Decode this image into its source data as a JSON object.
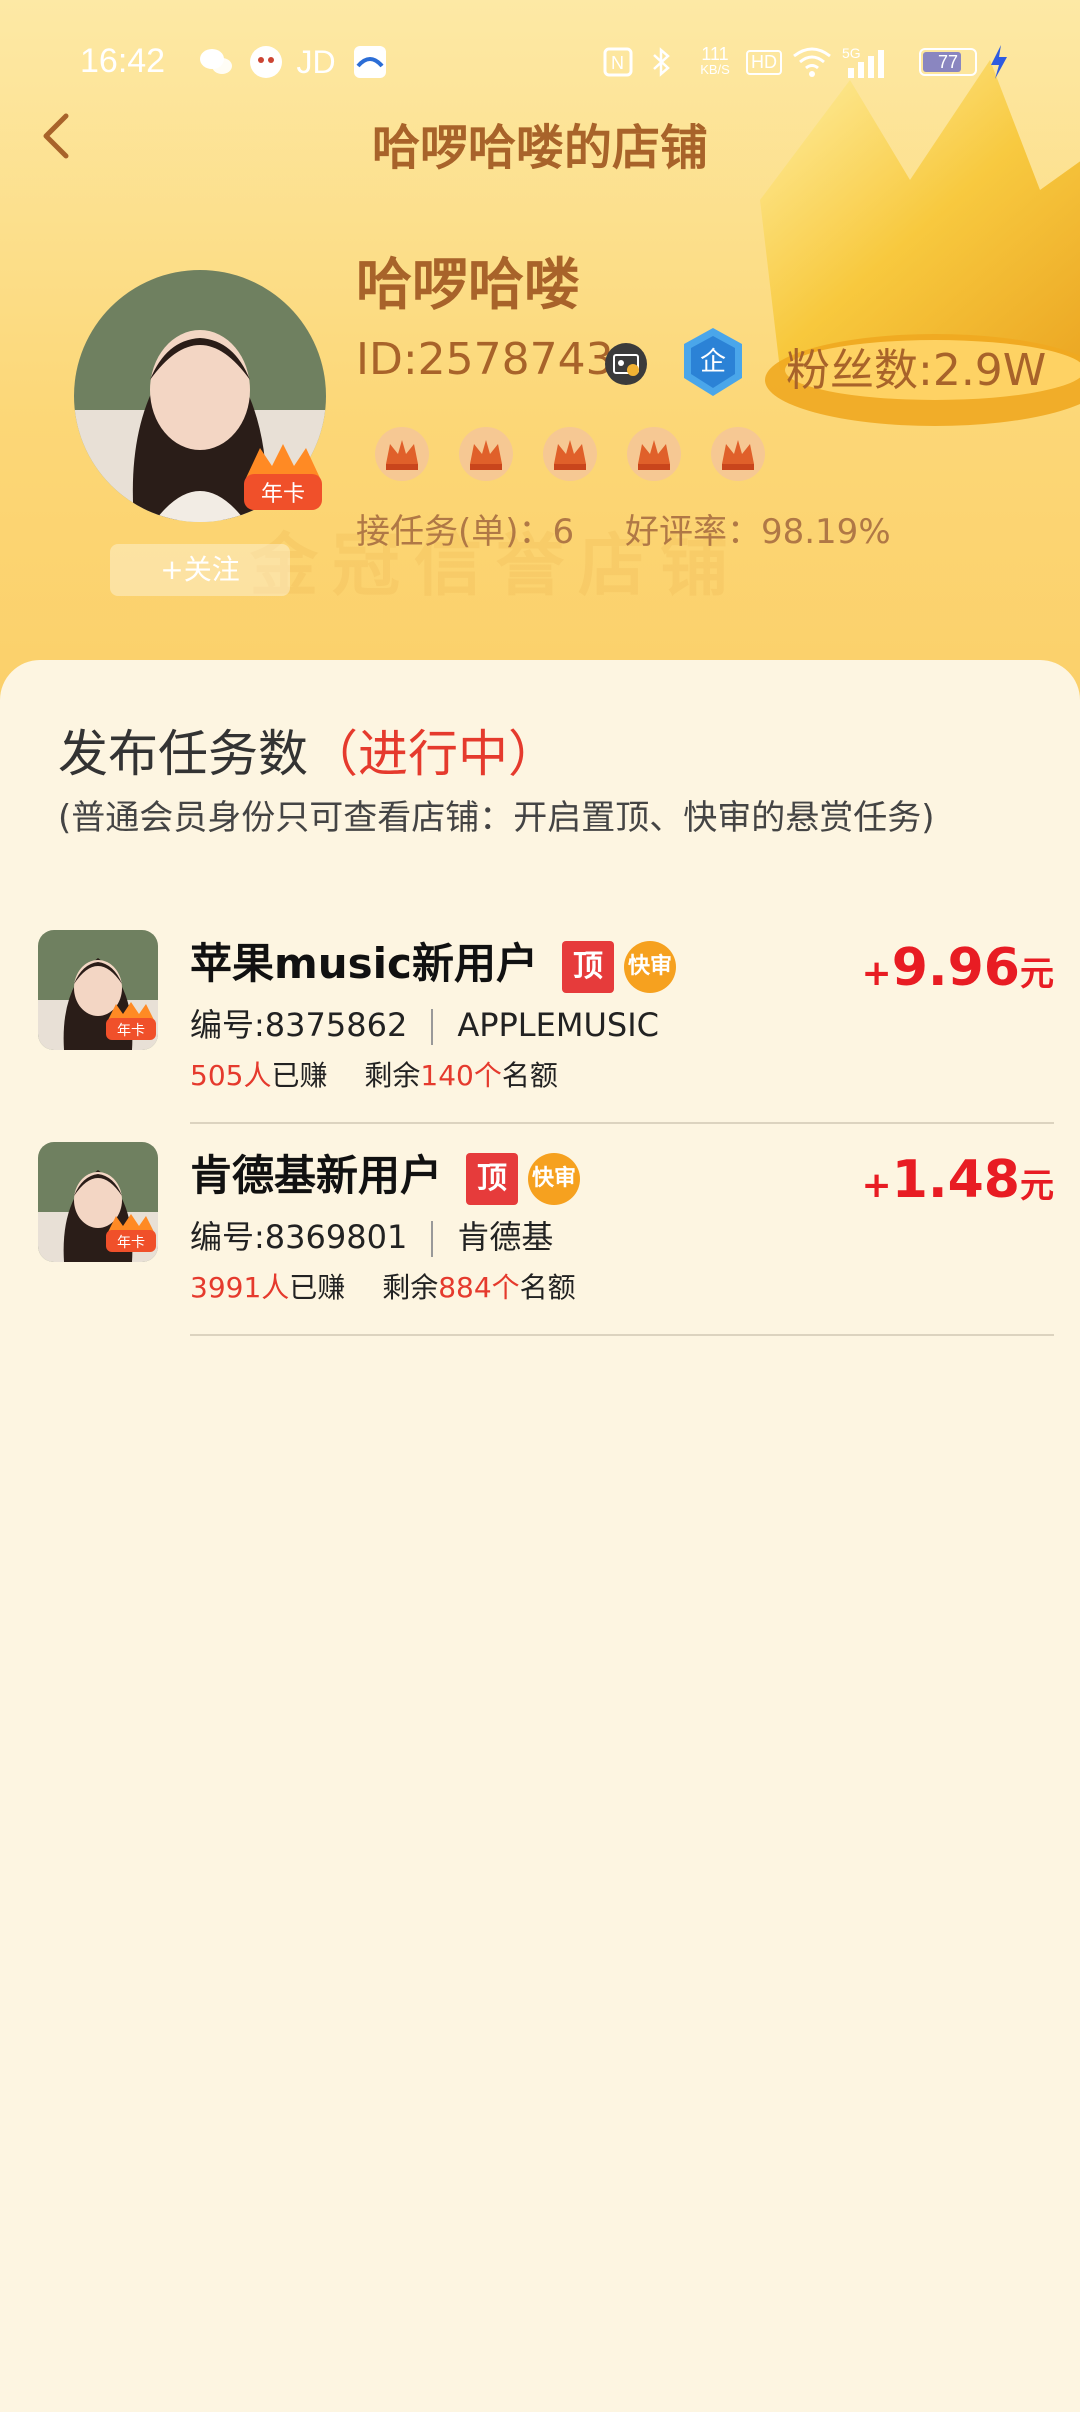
{
  "status_bar": {
    "time": "16:42",
    "app_icons": [
      "wechat-icon",
      "app-icon",
      "jd-icon",
      "app-icon"
    ],
    "jd_text": "JD",
    "net_speed": "111",
    "net_unit": "KB/S",
    "hd": "HD",
    "signal": "5G",
    "battery": "77"
  },
  "nav": {
    "title": "哈啰哈喽的店铺"
  },
  "profile": {
    "name": "哈啰哈喽",
    "id": "ID:2578743",
    "fans": "粉丝数:2.9W",
    "badge_label": "年卡",
    "follow_label": "+关注",
    "tasks_taken": "接任务(单)：6",
    "good_rate": "好评率：98.19%",
    "rank_crowns": 5,
    "enterprise_label": "企",
    "watermark": "金冠信誉店铺"
  },
  "section": {
    "title": "发布任务数",
    "status": "（进行中）",
    "note": "(普通会员身份只可查看店铺：开启置顶、快审的悬赏任务)"
  },
  "tasks": [
    {
      "name": "苹果music新用户",
      "tag_top": "顶",
      "tag_fast": "快审",
      "number": "编号:8375862",
      "category": "APPLEMUSIC",
      "earned_count": "505人",
      "earned_label": "已赚",
      "remain_label": "剩余",
      "remain_count": "140个",
      "quota_label": "名额",
      "reward_plus": "+",
      "reward": "9.96",
      "reward_unit": "元",
      "badge_label": "年卡"
    },
    {
      "name": "肯德基新用户",
      "tag_top": "顶",
      "tag_fast": "快审",
      "number": "编号:8369801",
      "category": "肯德基",
      "earned_count": "3991人",
      "earned_label": "已赚",
      "remain_label": "剩余",
      "remain_count": "884个",
      "quota_label": "名额",
      "reward_plus": "+",
      "reward": "1.48",
      "reward_unit": "元",
      "badge_label": "年卡"
    }
  ],
  "colors": {
    "brand_brown": "#a8632a",
    "accent_red": "#e53a2d",
    "reward_red": "#e81c23",
    "tag_top": "#e63b3b",
    "tag_fast": "#f6a11f",
    "card_bg": "#fdf5e1"
  }
}
